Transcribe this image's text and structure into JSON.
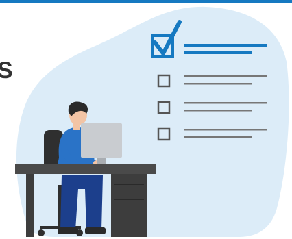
{
  "illustration": {
    "subject": "person-at-desk-with-checklist",
    "colors": {
      "accent": "#1679c1",
      "background_blob": "#dcecf8",
      "desk": "#3d3d3d",
      "desk_top": "#4a4a4a",
      "monitor": "#c9ccd0",
      "shirt": "#2a73c7",
      "pants": "#1c3f8c",
      "skin": "#f2c4a5",
      "hair": "#2a2a2a",
      "chair": "#2f2f2f",
      "checkbox_empty": "#555555",
      "line_gray": "#777777"
    },
    "checklist": {
      "items": [
        {
          "checked": true
        },
        {
          "checked": false
        },
        {
          "checked": false
        },
        {
          "checked": false
        }
      ]
    },
    "icons": [
      "checkbox-checked-icon",
      "checkbox-empty-icon"
    ],
    "cropped_text_fragment": "S"
  }
}
